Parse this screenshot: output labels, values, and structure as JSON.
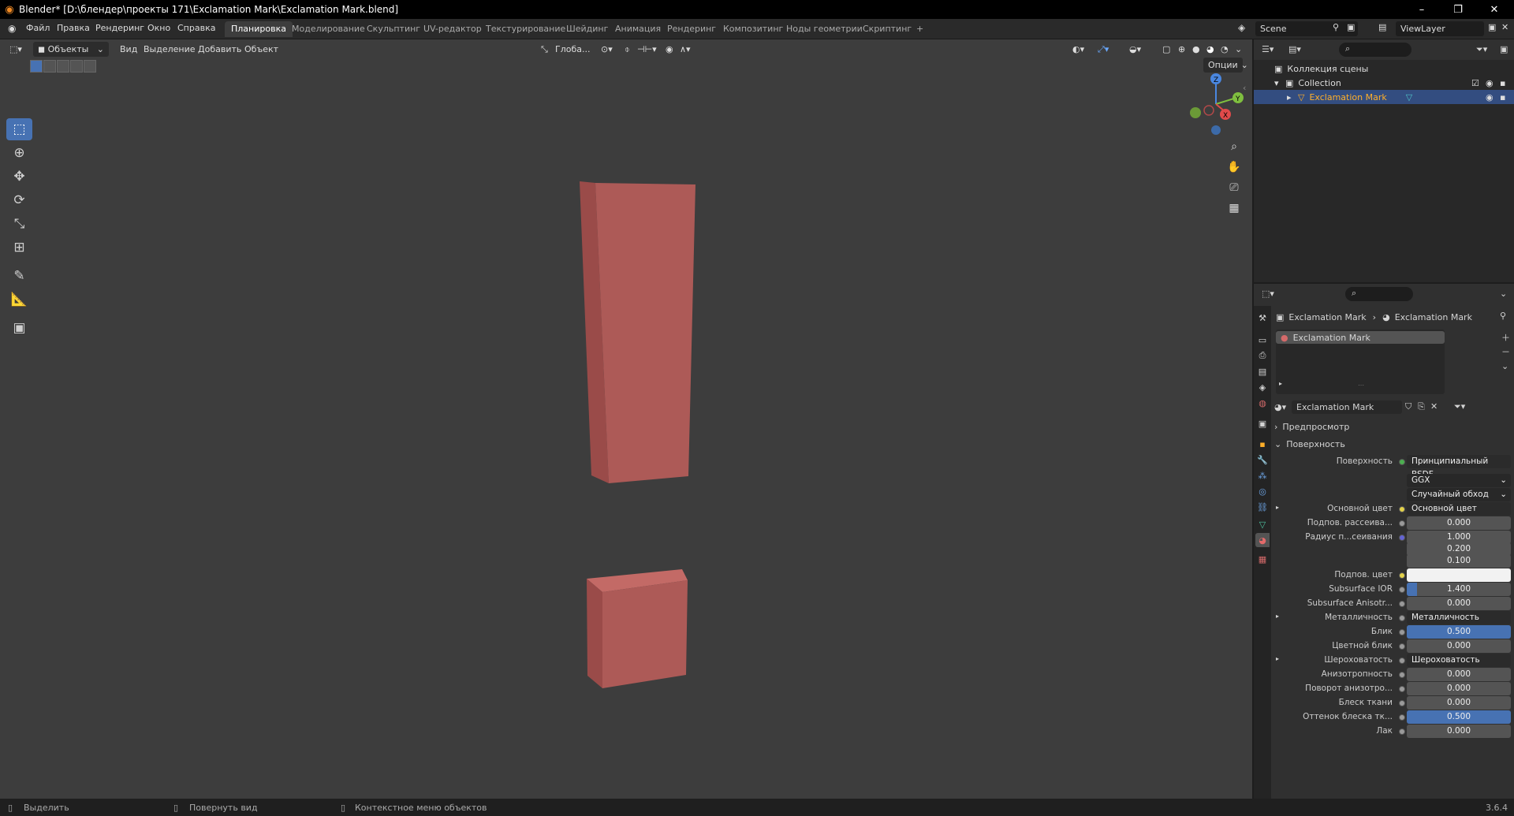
{
  "window": {
    "title": "Blender* [D:\\блендер\\проекты 171\\Exclamation Mark\\Exclamation Mark.blend]",
    "minimize": "–",
    "maximize": "❐",
    "close": "✕"
  },
  "menu": [
    "Файл",
    "Правка",
    "Рендеринг",
    "Окно",
    "Справка"
  ],
  "workspaces": [
    "Планировка",
    "Моделирование",
    "Скульптинг",
    "UV-редактор",
    "Текстурирование",
    "Шейдинг",
    "Анимация",
    "Рендеринг",
    "Композитинг",
    "Ноды геометрии",
    "Скриптинг",
    "+"
  ],
  "active_workspace": "Планировка",
  "scene": "Scene",
  "view_layer": "ViewLayer",
  "viewport": {
    "mode": "Объекты",
    "menus": [
      "Вид",
      "Выделение",
      "Добавить",
      "Объект"
    ],
    "orientation": "Глоба...",
    "options": "Опции",
    "object_color": "#ad5a57"
  },
  "outliner": {
    "scene_collection": "Коллекция сцены",
    "collection": "Collection",
    "object": "Exclamation Mark"
  },
  "properties": {
    "breadcrumb_object": "Exclamation Mark",
    "breadcrumb_material": "Exclamation Mark",
    "slot": "Exclamation Mark",
    "material_name": "Exclamation Mark",
    "panel_preview": "Предпросмотр",
    "panel_surface": "Поверхность",
    "rows": [
      {
        "label": "Поверхность",
        "value": "Принципиальный BSDF",
        "kind": "link",
        "dot": "#4caf50"
      },
      {
        "label": "",
        "value": "GGX",
        "kind": "dd"
      },
      {
        "label": "",
        "value": "Случайный обход",
        "kind": "dd"
      },
      {
        "label": "Основной цвет",
        "value": "Основной цвет",
        "kind": "link",
        "dot": "#e3d24a",
        "expander": true
      },
      {
        "label": "Подпов. рассеива...",
        "value": "0.000",
        "kind": "num",
        "dot": "#9a9a9a"
      },
      {
        "label": "Радиус п...сеивания",
        "value": "1.000",
        "kind": "num",
        "dot": "#6464d2"
      },
      {
        "label": "",
        "value": "0.200",
        "kind": "num"
      },
      {
        "label": "",
        "value": "0.100",
        "kind": "num"
      },
      {
        "label": "Подпов. цвет",
        "value": "",
        "kind": "color",
        "dot": "#e3d24a"
      },
      {
        "label": "Subsurface IOR",
        "value": "1.400",
        "kind": "slider",
        "fill": 0.1,
        "dot": "#9a9a9a"
      },
      {
        "label": "Subsurface Anisotr...",
        "value": "0.000",
        "kind": "num",
        "dot": "#9a9a9a"
      },
      {
        "label": "Металличность",
        "value": "Металличность",
        "kind": "link",
        "dot": "#9a9a9a",
        "expander": true
      },
      {
        "label": "Блик",
        "value": "0.500",
        "kind": "slider",
        "fill": 1.0,
        "dot": "#9a9a9a"
      },
      {
        "label": "Цветной блик",
        "value": "0.000",
        "kind": "num",
        "dot": "#9a9a9a"
      },
      {
        "label": "Шероховатость",
        "value": "Шероховатость",
        "kind": "link",
        "dot": "#9a9a9a",
        "expander": true
      },
      {
        "label": "Анизотропность",
        "value": "0.000",
        "kind": "num",
        "dot": "#9a9a9a"
      },
      {
        "label": "Поворот анизотро...",
        "value": "0.000",
        "kind": "num",
        "dot": "#9a9a9a"
      },
      {
        "label": "Блеск ткани",
        "value": "0.000",
        "kind": "num",
        "dot": "#9a9a9a"
      },
      {
        "label": "Оттенок блеска тк...",
        "value": "0.500",
        "kind": "slider",
        "fill": 1.0,
        "dot": "#9a9a9a"
      },
      {
        "label": "Лак",
        "value": "0.000",
        "kind": "num",
        "dot": "#9a9a9a"
      }
    ]
  },
  "status": {
    "select": "Выделить",
    "rotate": "Повернуть вид",
    "context_menu": "Контекстное меню объектов",
    "version": "3.6.4"
  }
}
